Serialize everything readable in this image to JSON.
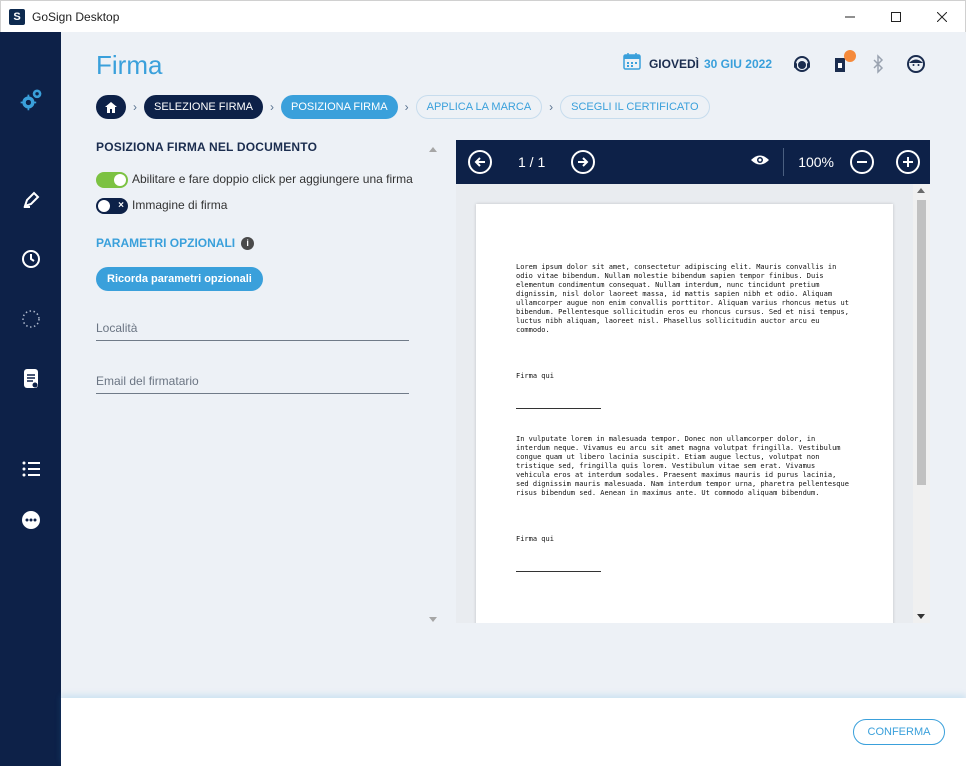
{
  "window": {
    "title": "GoSign Desktop"
  },
  "header": {
    "page_title": "Firma",
    "date_day": "GIOVEDÌ",
    "date_date": "30 GIU 2022"
  },
  "breadcrumb": {
    "steps": [
      {
        "label": "SELEZIONE FIRMA"
      },
      {
        "label": "POSIZIONA FIRMA"
      },
      {
        "label": "APPLICA LA MARCA"
      },
      {
        "label": "SCEGLI IL CERTIFICATO"
      }
    ]
  },
  "form": {
    "title": "POSIZIONA FIRMA NEL DOCUMENTO",
    "toggle_double_click": {
      "label": "Abilitare e fare doppio click per aggiungere una firma",
      "on": true
    },
    "toggle_image": {
      "label": "Immagine di firma",
      "on": false
    },
    "optional_title": "PARAMETRI OPZIONALI",
    "remember_button": "Ricorda parametri opzionali",
    "location_placeholder": "Località",
    "email_placeholder": "Email del firmatario"
  },
  "viewer": {
    "page_indicator": "1 / 1",
    "zoom": "100%",
    "document": {
      "paragraph1": "Lorem ipsum dolor sit amet, consectetur adipiscing elit. Mauris convallis in odio vitae bibendum. Nullam molestie bibendum sapien tempor finibus. Duis elementum condimentum consequat. Nullam interdum, nunc tincidunt pretium dignissim, nisl dolor laoreet massa, id mattis sapien nibh et odio. Aliquam ullamcorper augue non enim convallis porttitor. Aliquam varius rhoncus metus ut bibendum. Pellentesque sollicitudin eros eu rhoncus cursus. Sed et nisi tempus, luctus nibh aliquam, laoreet nisl. Phasellus sollicitudin auctor arcu eu commodo.",
      "sign_label_1": "Firma qui",
      "paragraph2": "In vulputate lorem in malesuada tempor. Donec non ullamcorper dolor, in interdum neque. Vivamus eu arcu sit amet magna volutpat fringilla. Vestibulum congue quam ut libero lacinia suscipit. Etiam augue lectus, volutpat non tristique sed, fringilla quis lorem. Vestibulum vitae sem erat. Vivamus vehicula eros at interdum sodales. Praesent maximus mauris id purus lacinia, sed dignissim mauris malesuada. Nam interdum tempor urna, pharetra pellentesque risus bibendum sed. Aenean in maximus ante. Ut commodo aliquam bibendum.",
      "sign_label_2": "Firma qui"
    }
  },
  "footer": {
    "confirm_label": "CONFERMA"
  },
  "colors": {
    "sidebar": "#0d2148",
    "accent": "#3aa0db",
    "toggle_on": "#7cc242",
    "notification": "#f58a3b",
    "background": "#edf1f6"
  },
  "icons": [
    "settings-gears-icon",
    "pen-sign-icon",
    "history-clock-icon",
    "loading-dots-icon",
    "document-icon",
    "checklist-icon",
    "more-icon",
    "calendar-icon",
    "support-agent-icon",
    "notification-icon",
    "bluetooth-icon",
    "user-face-icon",
    "home-icon",
    "info-icon",
    "arrow-left-icon",
    "arrow-right-icon",
    "eye-icon",
    "zoom-out-icon",
    "zoom-in-icon"
  ]
}
